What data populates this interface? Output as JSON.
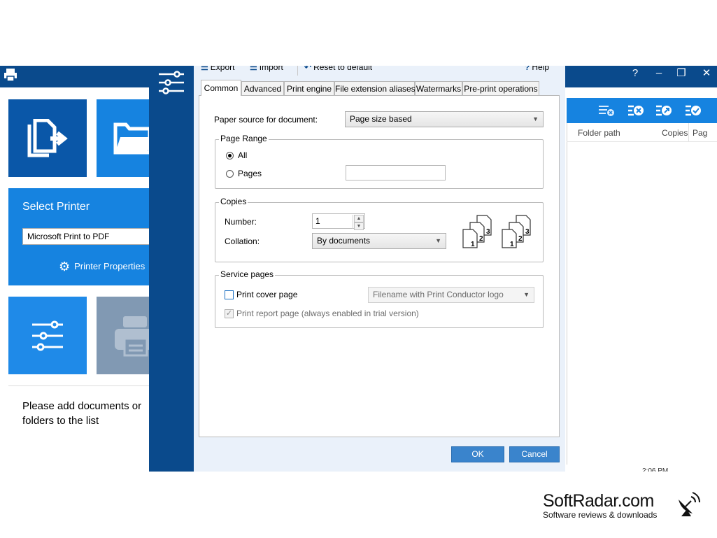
{
  "app": {
    "tiles": {
      "select_printer_title": "Select Printer",
      "printer_selected": "Microsoft Print to PDF",
      "printer_properties": "Printer Properties"
    },
    "empty_message": "Please add documents or folders to the list",
    "list_columns": [
      "Folder path",
      "Copies",
      "Pag"
    ],
    "status_time": "2:06 PM",
    "window_buttons": [
      "?",
      "–",
      "❐",
      "✕"
    ]
  },
  "dialog": {
    "toolbar": {
      "export": "Export",
      "import": "Import",
      "reset": "Reset to default",
      "help": "Help"
    },
    "tabs": [
      "Common",
      "Advanced",
      "Print engine",
      "File extension aliases",
      "Watermarks",
      "Pre-print operations"
    ],
    "active_tab": "Common",
    "paper_source": {
      "label": "Paper source for document:",
      "value": "Page size based"
    },
    "page_range": {
      "title": "Page Range",
      "all_label": "All",
      "pages_label": "Pages",
      "selected": "All",
      "pages_value": ""
    },
    "copies": {
      "title": "Copies",
      "number_label": "Number:",
      "number_value": "1",
      "collation_label": "Collation:",
      "collation_value": "By documents"
    },
    "service_pages": {
      "title": "Service pages",
      "cover_label": "Print cover page",
      "cover_checked": false,
      "cover_template": "Filename with Print Conductor logo",
      "report_label": "Print report page (always enabled in trial version)",
      "report_checked": true
    },
    "buttons": {
      "ok": "OK",
      "cancel": "Cancel"
    }
  },
  "watermark": {
    "title": "SoftRadar.com",
    "subtitle": "Software reviews & downloads"
  },
  "colors": {
    "dark_blue": "#0a4a8c",
    "tile_blue": "#1683e0",
    "tile_dark": "#0a57a8",
    "tile_grey": "#8199b3",
    "button_blue": "#3a84cc"
  }
}
